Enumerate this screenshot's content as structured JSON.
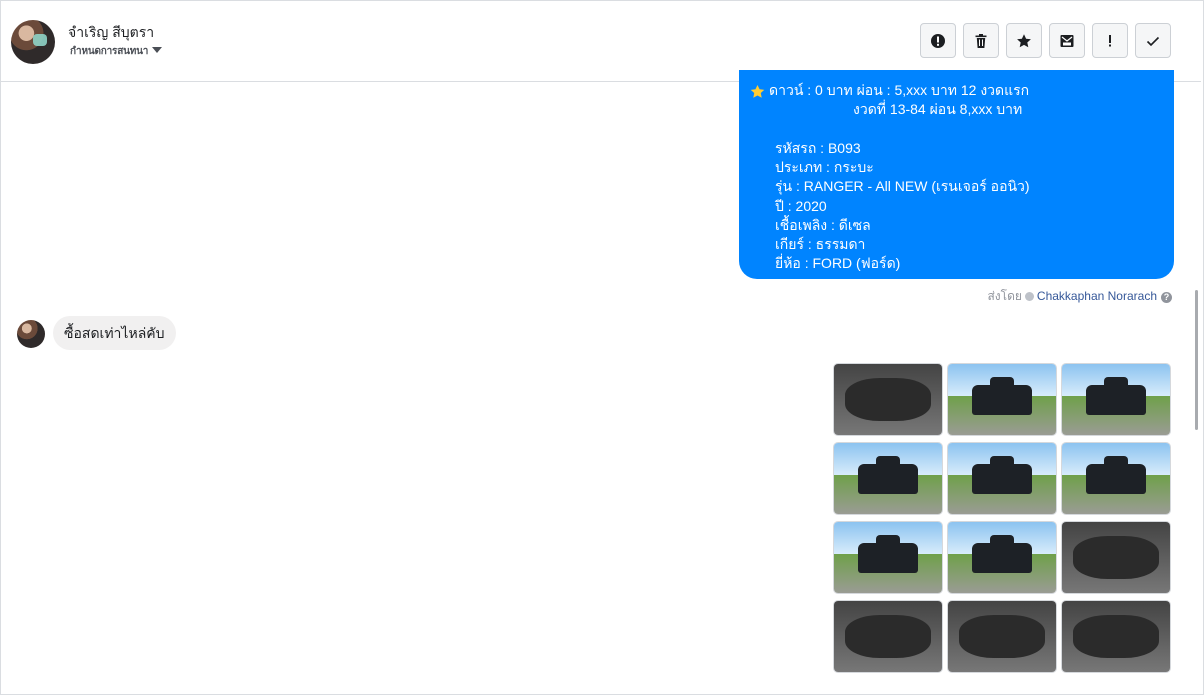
{
  "header": {
    "contact_name": "จำเริญ สีบุตรา",
    "contact_sub": "กำหนดการสนทนา",
    "tools": [
      {
        "icon": "alert-circle-icon"
      },
      {
        "icon": "trash-icon"
      },
      {
        "icon": "star-icon"
      },
      {
        "icon": "mark-unread-icon"
      },
      {
        "icon": "exclamation-icon"
      },
      {
        "icon": "check-icon"
      }
    ]
  },
  "outgoing_message": {
    "lines": [
      "ดาวน์ : 0 บาท ผ่อน : 5,xxx บาท 12 งวดแรก",
      "งวดที่ 13-84 ผ่อน 8,xxx บาท",
      "รหัสรถ : B093",
      "ประเภท : กระบะ",
      "รุ่น : RANGER - All NEW (เรนเจอร์ ออนิว)",
      "ปี : 2020",
      "เชื้อเพลิง : ดีเซล",
      "เกียร์ : ธรรมดา",
      "ยี่ห้อ : FORD (ฟอร์ด)"
    ],
    "sent_by_label": "ส่งโดย",
    "sent_by_name": "Chakkaphan Norarach",
    "help_glyph": "?"
  },
  "incoming_message": {
    "text": "ซื้อสดเท่าไหล่คับ"
  },
  "photos": [
    {
      "kind": "dashboard"
    },
    {
      "kind": "exterior"
    },
    {
      "kind": "exterior"
    },
    {
      "kind": "exterior"
    },
    {
      "kind": "exterior"
    },
    {
      "kind": "exterior"
    },
    {
      "kind": "exterior"
    },
    {
      "kind": "exterior"
    },
    {
      "kind": "interior"
    },
    {
      "kind": "interior"
    },
    {
      "kind": "interior"
    },
    {
      "kind": "engine"
    }
  ],
  "colors": {
    "message_blue": "#0084ff",
    "incoming_grey": "#f1f0f0",
    "link": "#365899"
  }
}
